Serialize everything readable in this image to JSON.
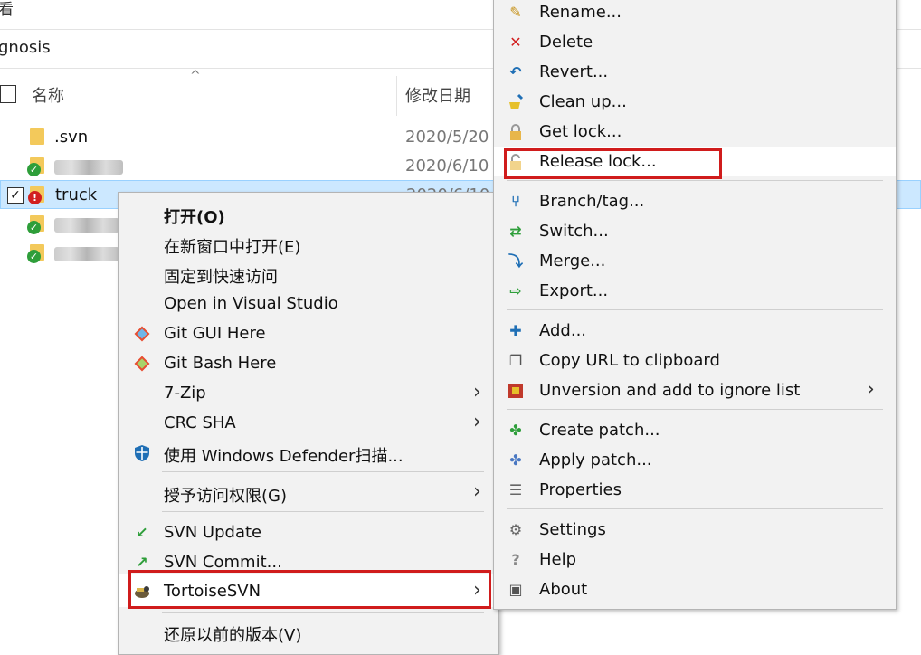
{
  "explorer": {
    "top_fragment": "看",
    "path_fragment": "gnosis",
    "header": {
      "name": "名称",
      "date": "修改日期"
    },
    "files": [
      {
        "name": ".svn",
        "date": "2020/5/20",
        "status": "none"
      },
      {
        "name": "",
        "date": "2020/6/10",
        "status": "ok"
      },
      {
        "name": "truck",
        "date": "2020/6/10",
        "status": "modified",
        "selected": true
      },
      {
        "name": "",
        "date": "",
        "status": "ok"
      },
      {
        "name": "",
        "date": "",
        "status": "ok"
      }
    ]
  },
  "context_menu": {
    "items": [
      {
        "label": "打开(O)",
        "icon": ""
      },
      {
        "label": "在新窗口中打开(E)",
        "icon": ""
      },
      {
        "label": "固定到快速访问",
        "icon": ""
      },
      {
        "label": "Open in Visual Studio",
        "icon": ""
      },
      {
        "label": "Git GUI Here",
        "icon": "git-gui-icon"
      },
      {
        "label": "Git Bash Here",
        "icon": "git-bash-icon"
      },
      {
        "label": "7-Zip",
        "icon": ""
      },
      {
        "label": "CRC SHA",
        "icon": ""
      },
      {
        "label": "使用 Windows Defender扫描...",
        "icon": "windows-defender-icon"
      },
      {
        "label": "授予访问权限(G)",
        "icon": ""
      },
      {
        "label": "SVN Update",
        "icon": "svn-update-icon"
      },
      {
        "label": "SVN Commit...",
        "icon": "svn-commit-icon"
      },
      {
        "label": "TortoiseSVN",
        "icon": "tortoisesvn-icon"
      },
      {
        "label": "还原以前的版本(V)",
        "icon": ""
      }
    ]
  },
  "svn_submenu": {
    "items": [
      {
        "label": "Rename...",
        "icon": "rename-icon"
      },
      {
        "label": "Delete",
        "icon": "delete-icon"
      },
      {
        "label": "Revert...",
        "icon": "revert-icon"
      },
      {
        "label": "Clean up...",
        "icon": "cleanup-icon"
      },
      {
        "label": "Get lock...",
        "icon": "get-lock-icon"
      },
      {
        "label": "Release lock...",
        "icon": "release-lock-icon"
      },
      {
        "label": "Branch/tag...",
        "icon": "branch-tag-icon"
      },
      {
        "label": "Switch...",
        "icon": "switch-icon"
      },
      {
        "label": "Merge...",
        "icon": "merge-icon"
      },
      {
        "label": "Export...",
        "icon": "export-icon"
      },
      {
        "label": "Add...",
        "icon": "add-icon"
      },
      {
        "label": "Copy URL to clipboard",
        "icon": "copy-url-icon"
      },
      {
        "label": "Unversion and add to ignore list",
        "icon": "unversion-icon"
      },
      {
        "label": "Create patch...",
        "icon": "create-patch-icon"
      },
      {
        "label": "Apply patch...",
        "icon": "apply-patch-icon"
      },
      {
        "label": "Properties",
        "icon": "properties-icon"
      },
      {
        "label": "Settings",
        "icon": "settings-icon"
      },
      {
        "label": "Help",
        "icon": "help-icon"
      },
      {
        "label": "About",
        "icon": "about-icon"
      }
    ]
  },
  "colors": {
    "highlight_border": "#d01c1c",
    "selection_bg": "#cce8ff",
    "menu_bg": "#f2f2f2"
  }
}
